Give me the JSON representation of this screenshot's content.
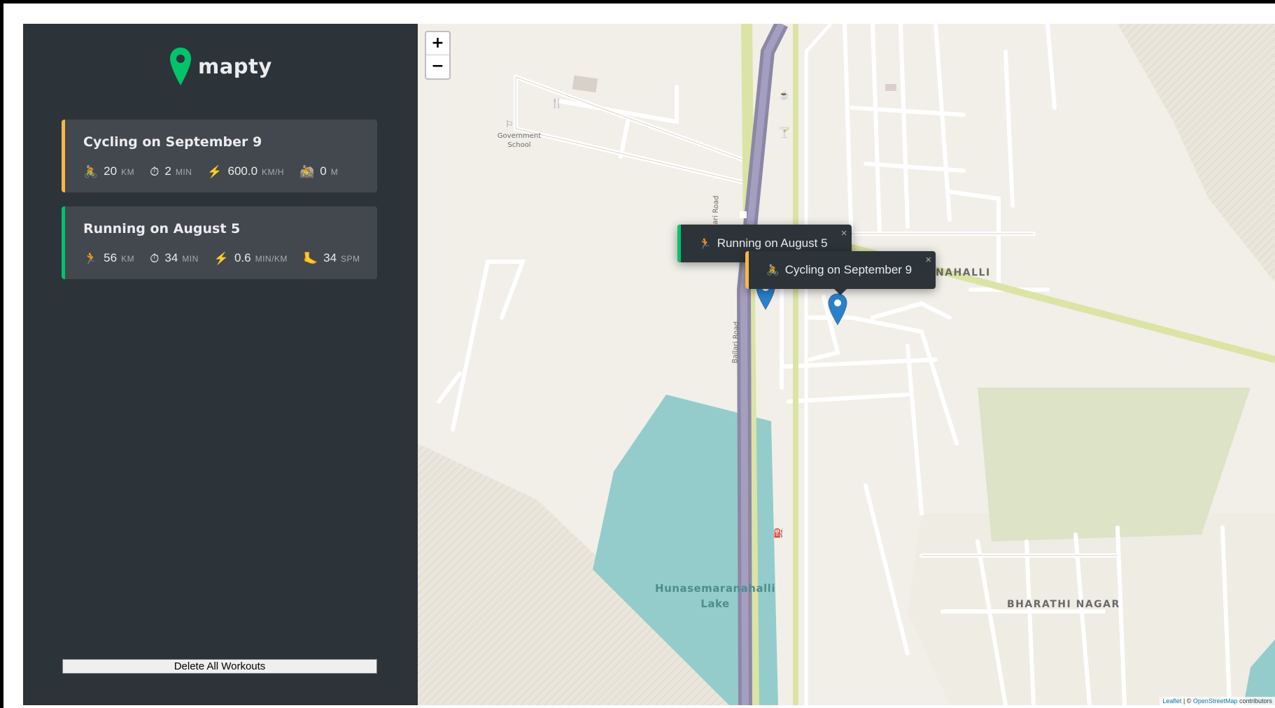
{
  "app": {
    "logo_text": "mapty"
  },
  "workouts": [
    {
      "type": "cycling",
      "title": "Cycling on September 9",
      "color": "#ffb545",
      "details": [
        {
          "icon": "cycling-icon",
          "glyph": "🚴",
          "value": "20",
          "unit": "km"
        },
        {
          "icon": "stopwatch-icon",
          "glyph": "⏱",
          "value": "2",
          "unit": "min"
        },
        {
          "icon": "lightning-icon",
          "glyph": "⚡",
          "value": "600.0",
          "unit": "km/h"
        },
        {
          "icon": "mountain-biker-icon",
          "glyph": "🚵",
          "value": "0",
          "unit": "m"
        }
      ]
    },
    {
      "type": "running",
      "title": "Running on August 5",
      "color": "#00c46a",
      "details": [
        {
          "icon": "runner-icon",
          "glyph": "🏃",
          "value": "56",
          "unit": "km"
        },
        {
          "icon": "stopwatch-icon",
          "glyph": "⏱",
          "value": "34",
          "unit": "min"
        },
        {
          "icon": "lightning-icon",
          "glyph": "⚡",
          "value": "0.6",
          "unit": "min/km"
        },
        {
          "icon": "footprint-icon",
          "glyph": "🦶",
          "value": "34",
          "unit": "spm"
        }
      ]
    }
  ],
  "delete_button_label": "Delete All Workouts",
  "map": {
    "zoom_in": "+",
    "zoom_out": "−",
    "popups": [
      {
        "text": "Running on August 5",
        "icon": "runner-icon",
        "color": "#00c46a"
      },
      {
        "text": "Cycling on September 9",
        "icon": "cycling-icon",
        "color": "#ffb545"
      }
    ],
    "popup_close": "×",
    "labels": {
      "school": "Government School",
      "area1": "NAHALLI",
      "road1": "Ballari Road",
      "road2": "Ballari Road",
      "lake": "Hunasemaranahalli Lake",
      "area2": "BHARATHI NAGAR"
    },
    "attribution": {
      "leaflet": "Leaflet",
      "separator": " | © ",
      "osm": "OpenStreetMap",
      "suffix": " contributors"
    },
    "colors": {
      "land": "#f2efe9",
      "water": "#94cccb",
      "highway": "#8d87a6",
      "park": "#dde3c6"
    }
  }
}
